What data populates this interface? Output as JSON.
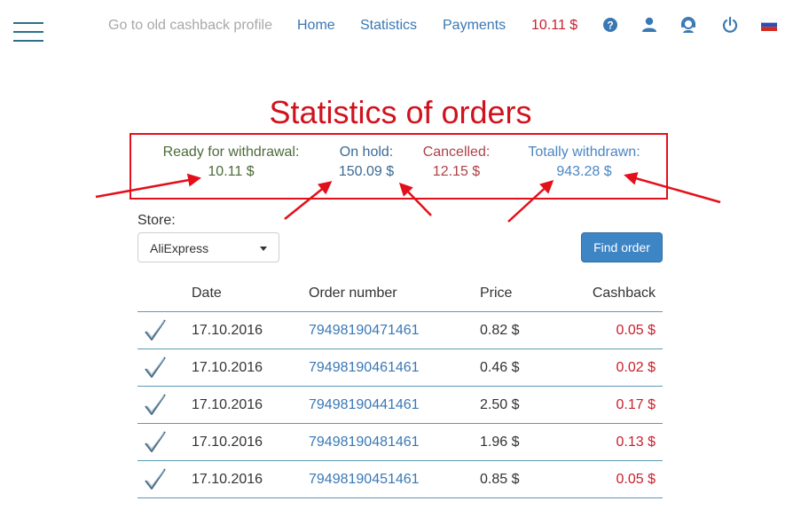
{
  "nav": {
    "old_profile": "Go to old cashback profile",
    "home": "Home",
    "statistics": "Statistics",
    "payments": "Payments",
    "balance": "10.11 $"
  },
  "icons": {
    "menu": "hamburger-menu-icon",
    "help": "question-circle-icon",
    "user": "user-icon",
    "support": "support-agent-icon",
    "logout": "power-icon",
    "language": "russian-flag-icon"
  },
  "page": {
    "title": "Statistics of orders"
  },
  "summary": {
    "ready_label": "Ready for withdrawal:",
    "ready_value": "10.11 $",
    "hold_label": "On hold:",
    "hold_value": "150.09 $",
    "cancelled_label": "Cancelled:",
    "cancelled_value": "12.15 $",
    "withdrawn_label": "Totally withdrawn:",
    "withdrawn_value": "943.28 $"
  },
  "filter": {
    "store_label": "Store:",
    "store_selected": "AliExpress",
    "find_button": "Find order"
  },
  "table": {
    "headers": {
      "date": "Date",
      "order": "Order number",
      "price": "Price",
      "cashback": "Cashback"
    },
    "rows": [
      {
        "date": "17.10.2016",
        "order": "79498190471461",
        "price": "0.82 $",
        "cashback": "0.05 $"
      },
      {
        "date": "17.10.2016",
        "order": "79498190461461",
        "price": "0.46 $",
        "cashback": "0.02 $"
      },
      {
        "date": "17.10.2016",
        "order": "79498190441461",
        "price": "2.50 $",
        "cashback": "0.17 $"
      },
      {
        "date": "17.10.2016",
        "order": "79498190481461",
        "price": "1.96 $",
        "cashback": "0.13 $"
      },
      {
        "date": "17.10.2016",
        "order": "79498190451461",
        "price": "0.85 $",
        "cashback": "0.05 $"
      }
    ]
  },
  "colors": {
    "accent_red": "#d1121c",
    "link_blue": "#3a78b4",
    "ready_green": "#4d6a3a",
    "button_blue": "#3e85c6"
  }
}
